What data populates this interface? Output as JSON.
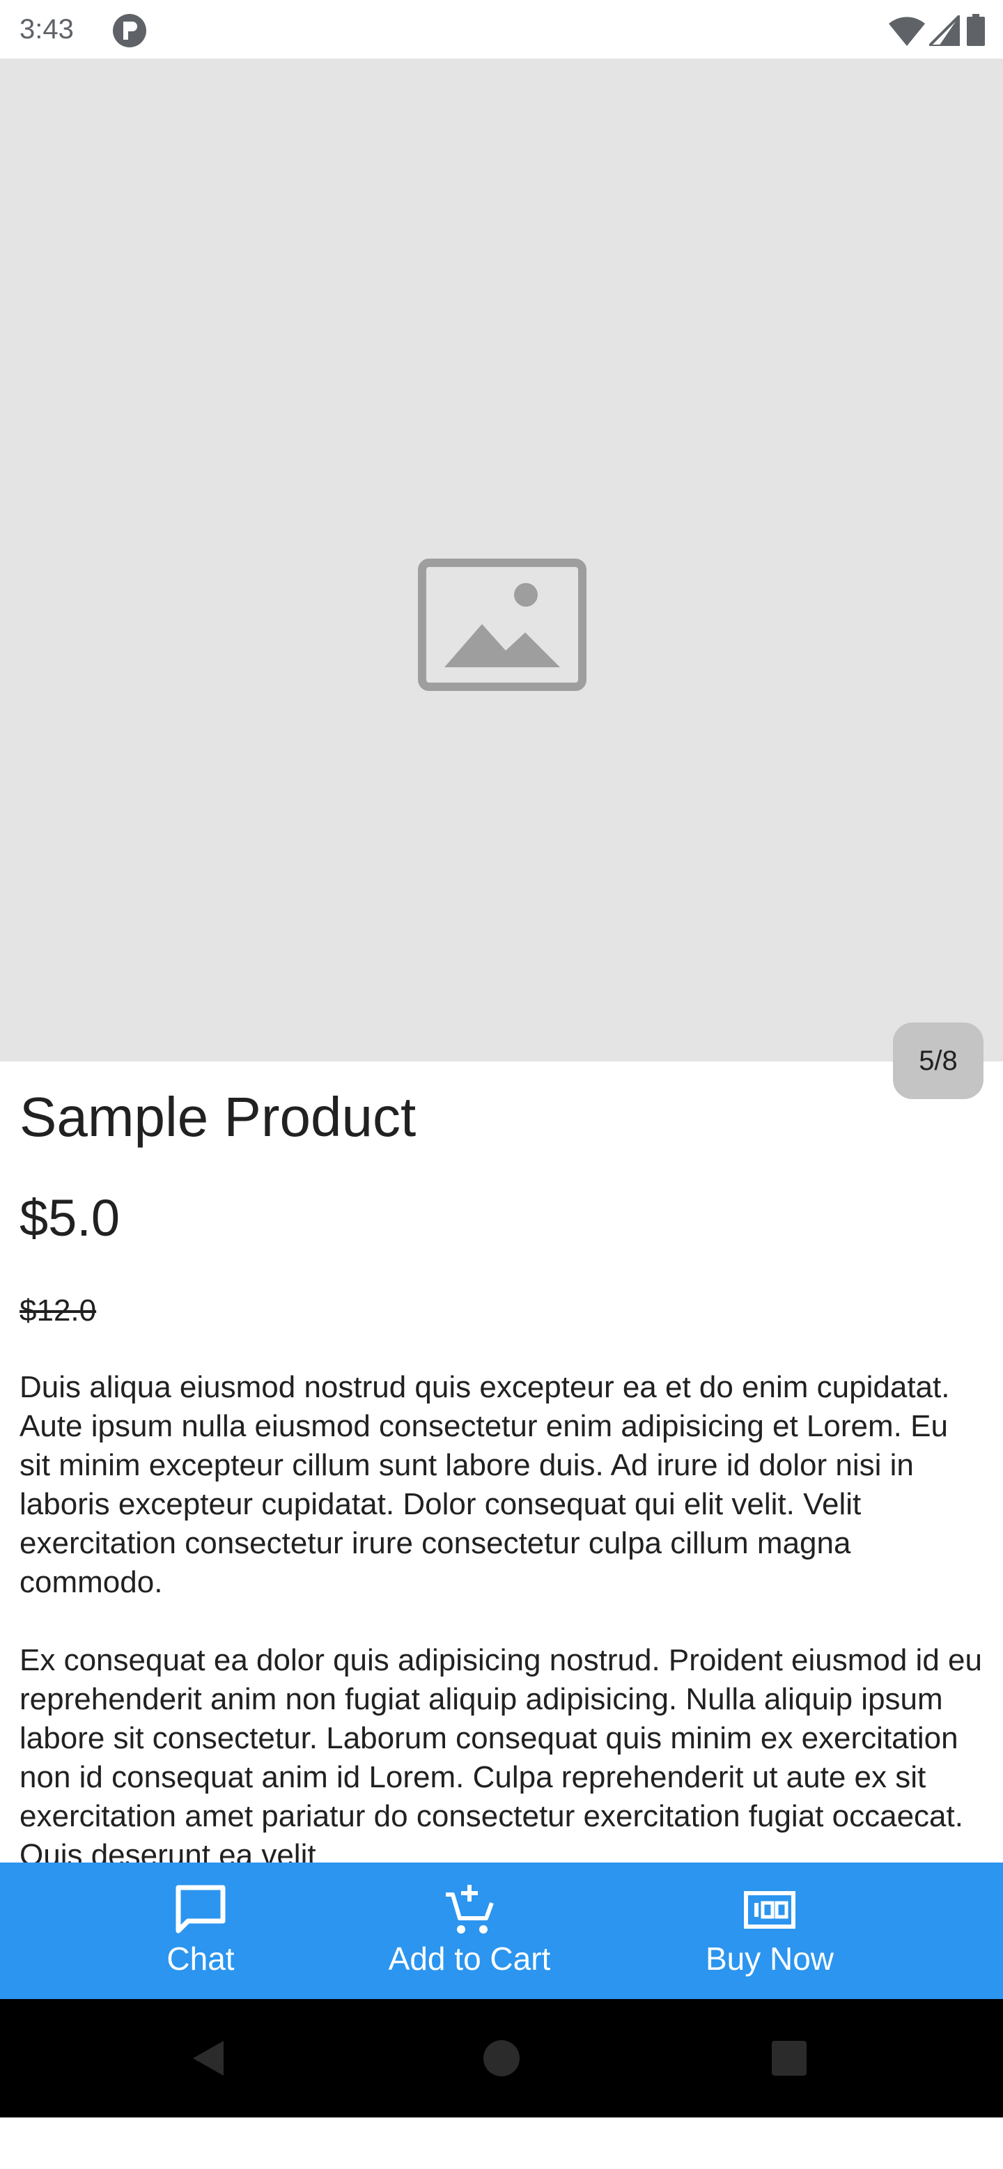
{
  "status_bar": {
    "time": "3:43",
    "icons": [
      "app-notification-icon",
      "wifi-icon",
      "signal-icon",
      "battery-icon"
    ]
  },
  "gallery": {
    "placeholder_icon": "image-placeholder-icon",
    "page_indicator": "5/8",
    "background_color": "#e4e4e4"
  },
  "product": {
    "title": "Sample Product",
    "price": "$5.0",
    "original_price": "$12.0",
    "description": [
      "Duis aliqua eiusmod nostrud quis excepteur ea et do enim cupidatat. Aute ipsum nulla eiusmod consectetur enim adipisicing et Lorem. Eu sit minim excepteur cillum sunt labore duis. Ad irure id dolor nisi in laboris excepteur cupidatat. Dolor consequat qui elit velit. Velit exercitation consectetur irure consectetur culpa cillum magna commodo.",
      "Ex consequat ea dolor quis adipisicing nostrud. Proident eiusmod id eu reprehenderit anim non fugiat aliquip adipisicing. Nulla aliquip ipsum labore sit consectetur. Laborum consequat quis minim ex exercitation non id consequat anim id Lorem. Culpa reprehenderit ut aute ex sit exercitation amet pariatur do consectetur exercitation fugiat occaecat. Quis deserunt ea velit"
    ]
  },
  "action_bar": {
    "background_color": "#2b95ef",
    "chat_label": "Chat",
    "chat_icon": "chat-bubble-icon",
    "add_to_cart_label": "Add to Cart",
    "add_to_cart_icon": "add-shopping-cart-icon",
    "buy_now_label": "Buy Now",
    "buy_now_icon": "money-icon"
  },
  "nav_bar": {
    "icons": [
      "back-icon",
      "home-icon",
      "recents-icon"
    ]
  }
}
